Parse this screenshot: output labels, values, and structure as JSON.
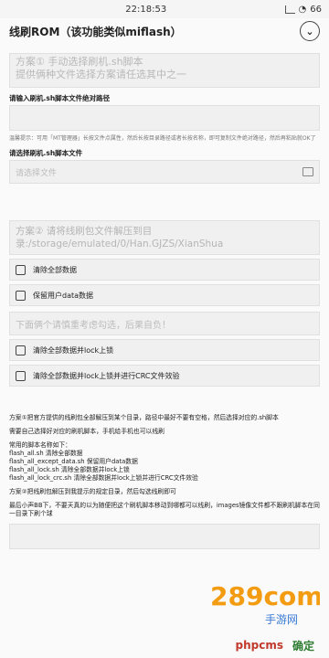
{
  "status": {
    "time": "22:18:53",
    "battery": "66"
  },
  "header": {
    "title": "线刷ROM（该功能类似miflash）"
  },
  "plan1": {
    "hint": "方案①  手动选择刷机.sh脚本\n提供俩种文件选择方案请任选其中之一"
  },
  "path_input": {
    "label": "请输入刷机.sh脚本文件绝对路径",
    "note": "温馨提示：可用「MT管理器」长按文件点属性，然后长按目录路径或者长按名称，即可复制文件绝对路径，然后再粘贴就OK了"
  },
  "script_select": {
    "label": "请选择刷机.sh脚本文件",
    "placeholder": "请选择文件"
  },
  "plan2": {
    "hint": "方案②  请将线刷包文件解压到目录:/storage/emulated/0/Han.GJZS/XianShua"
  },
  "options": [
    {
      "label": "清除全部数据"
    },
    {
      "label": "保留用户data数据"
    }
  ],
  "warning": "下面俩个请慎重考虑勾选，后果自负！",
  "options2": [
    {
      "label": "清除全部数据并lock上锁"
    },
    {
      "label": "清除全部数据并lock上锁并进行CRC文件效验"
    }
  ],
  "description": {
    "p1": "方案①把官方提供的线刷包全部解压到某个目录，路径中最好不要有空格，然后选择对应的.sh脚本",
    "p2": "需要自己选择好对应的刷机脚本，手机给手机也可以线刷",
    "p3_title": "常用的脚本名称如下：",
    "p3_lines": [
      "flash_all.sh 清除全部数据",
      "flash_all_except_data.sh 保留用户data数据",
      "flash_all_lock.sh 清除全部数据并lock上锁",
      "flash_all_lock_crc.sh 清除全部数据并lock上锁并进行CRC文件效验"
    ],
    "p4": "方案②把线刷包解压到我提示的规定目录，然后勾选线刷即可",
    "p5": "最后小声BB下，不要天真的以为随便把这个刷机脚本移动到哪都可以线刷，images镜像文件都不跟刷机脚本在同一目录下刷个球"
  },
  "logo": {
    "text": "289com",
    "sub": "手游网"
  },
  "bottom": {
    "brand": "phpcms",
    "confirm": "确定"
  }
}
